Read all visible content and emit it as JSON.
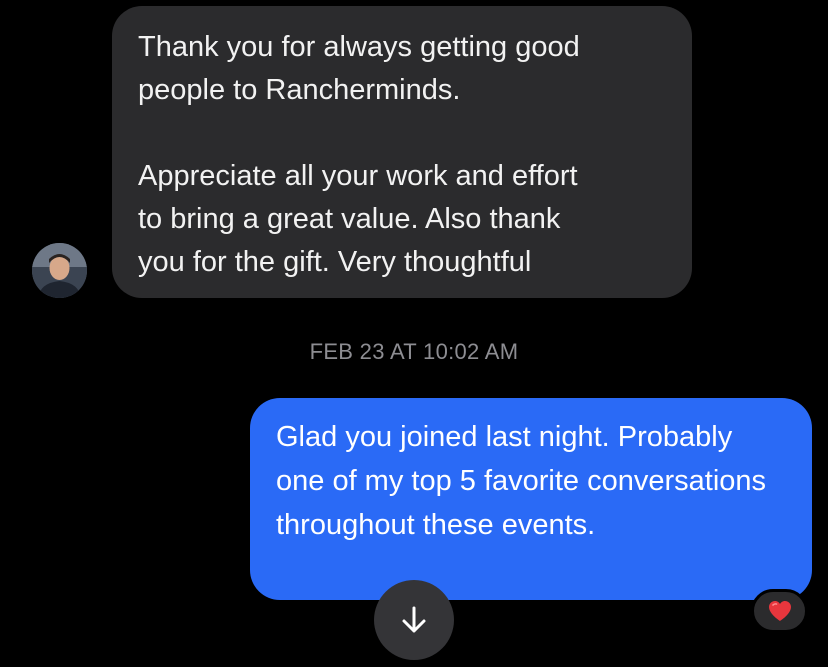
{
  "conversation": {
    "incoming_message": {
      "text": "Thank you for always getting good\npeople to Rancherminds.\n\nAppreciate all your work and effort\nto bring a great value. Also thank\nyou for the gift. Very thoughtful",
      "avatar_icon": "person-avatar-icon"
    },
    "timestamp": "FEB 23 AT 10:02 AM",
    "outgoing_message": {
      "text": "Glad you joined last night. Probably one of my top 5 favorite conversations throughout these events.",
      "reaction_icon": "heart-icon"
    },
    "scroll_button_icon": "arrow-down-icon"
  },
  "colors": {
    "background": "#000000",
    "incoming_bubble": "#2b2b2d",
    "outgoing_bubble": "#2a6af6",
    "timestamp_text": "#8d8d92",
    "heart": "#e8363d"
  }
}
